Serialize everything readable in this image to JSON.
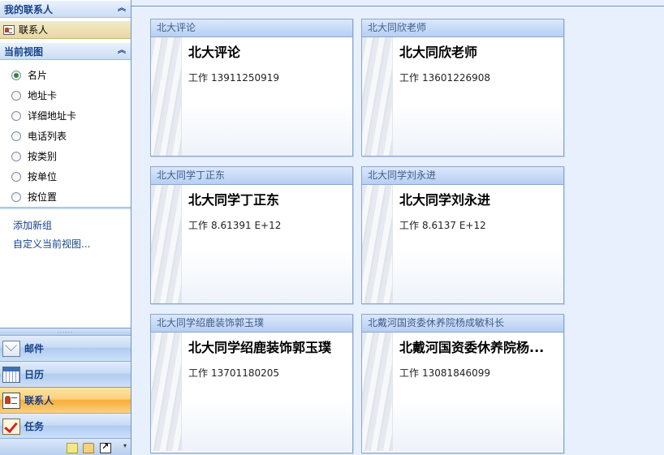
{
  "nav": {
    "my_contacts_header": "我的联系人",
    "contacts_folder": "联系人",
    "current_view_header": "当前视图",
    "views": [
      {
        "label": "名片",
        "checked": true
      },
      {
        "label": "地址卡",
        "checked": false
      },
      {
        "label": "详细地址卡",
        "checked": false
      },
      {
        "label": "电话列表",
        "checked": false
      },
      {
        "label": "按类别",
        "checked": false
      },
      {
        "label": "按单位",
        "checked": false
      },
      {
        "label": "按位置",
        "checked": false
      }
    ],
    "add_group_link": "添加新组",
    "customize_view_link": "自定义当前视图...",
    "buttons": {
      "mail": "邮件",
      "calendar": "日历",
      "contacts": "联系人",
      "tasks": "任务"
    },
    "splitter_grip": "......",
    "collapse_glyph": "«"
  },
  "cards": [
    {
      "title": "北大评论",
      "name": "北大评论",
      "phone_label": "工作",
      "phone": "13911250919"
    },
    {
      "title": "北大同欣老师",
      "name": "北大同欣老师",
      "phone_label": "工作",
      "phone": "13601226908"
    },
    {
      "title": "北大同学丁正东",
      "name": "北大同学丁正东",
      "phone_label": "工作",
      "phone": "8.61391 E+12"
    },
    {
      "title": "北大同学刘永进",
      "name": "北大同学刘永进",
      "phone_label": "工作",
      "phone": "8.6137 E+12"
    },
    {
      "title": "北大同学绍鹿装饰郭玉璞",
      "name": "北大同学绍鹿装饰郭玉璞",
      "phone_label": "工作",
      "phone": "13701180205"
    },
    {
      "title": "北戴河国资委休养院杨成敏科长",
      "name": "北戴河国资委休养院杨...",
      "phone_label": "工作",
      "phone": "13081846099"
    }
  ],
  "colors": {
    "nav_accent": "#15428b",
    "active_button": "#f7ad3b",
    "main_background": "#e7f0fc"
  }
}
